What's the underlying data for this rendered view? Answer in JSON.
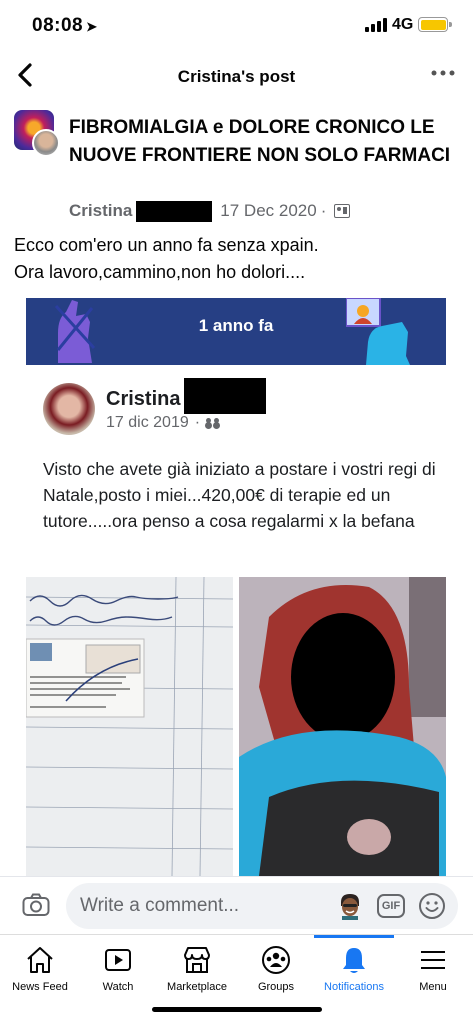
{
  "status_bar": {
    "time": "08:08",
    "network": "4G"
  },
  "header": {
    "title": "Cristina's post"
  },
  "post": {
    "group_name": "FIBROMIALGIA e DOLORE CRONICO LE NUOVE FRONTIERE NON SOLO FARMACI",
    "author": "Cristina",
    "date": "17 Dec 2020",
    "caption_line1": "Ecco com'ero un anno fa senza xpain.",
    "caption_line2": "Ora lavoro,cammino,non ho dolori...."
  },
  "memory": {
    "banner_label": "1 anno fa",
    "author": "Cristina",
    "date": "17 dic 2019",
    "text": "Visto che avete già iniziato a postare i vostri regi di Natale,posto i miei...420,00€ di terapie ed un tutore.....ora penso a cosa regalarmi x la befana"
  },
  "comment_bar": {
    "placeholder": "Write a comment...",
    "gif_label": "GIF"
  },
  "tabs": [
    {
      "label": "News Feed",
      "icon": "home-icon"
    },
    {
      "label": "Watch",
      "icon": "watch-icon"
    },
    {
      "label": "Marketplace",
      "icon": "marketplace-icon"
    },
    {
      "label": "Groups",
      "icon": "groups-icon"
    },
    {
      "label": "Notifications",
      "icon": "bell-icon",
      "active": true
    },
    {
      "label": "Menu",
      "icon": "menu-icon"
    }
  ],
  "colors": {
    "accent": "#1877f2",
    "banner": "#263f84",
    "battery": "#f7c600",
    "secondary_text": "#65676b"
  }
}
